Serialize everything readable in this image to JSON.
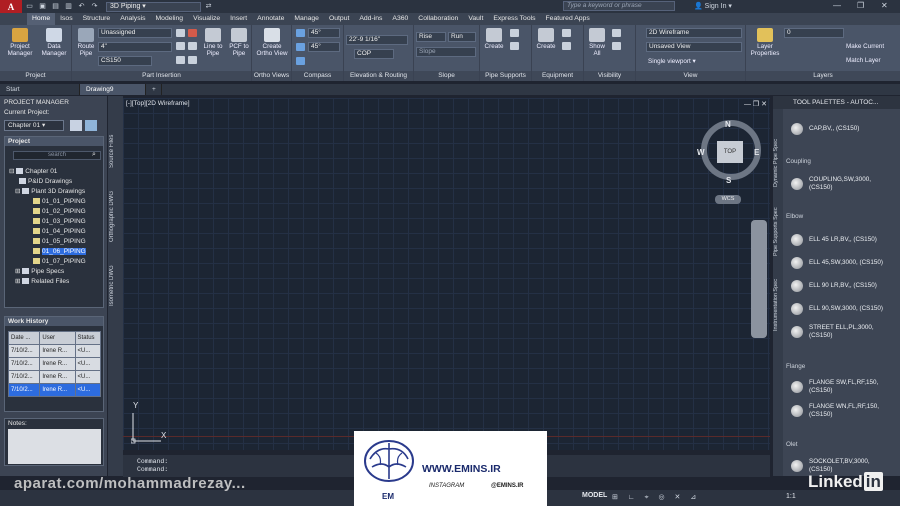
{
  "titlebar": {
    "logo": "A",
    "logo_sub": "P3D",
    "workspace": "3D Piping",
    "app_title": "",
    "search_placeholder": "Type a keyword or phrase",
    "signin": "Sign In"
  },
  "menubar": {
    "tabs": [
      "Home",
      "Isos",
      "Structure",
      "Analysis",
      "Modeling",
      "Visualize",
      "Insert",
      "Annotate",
      "Manage",
      "Output",
      "Add-ins",
      "A360",
      "Collaboration",
      "Vault",
      "Express Tools",
      "Featured Apps"
    ],
    "active": "Home"
  },
  "ribbon": {
    "project_panel": {
      "title": "Project",
      "buttons": [
        "Project Manager",
        "Data Manager"
      ]
    },
    "part_insertion": {
      "title": "Part Insertion",
      "buttons": [
        "Route Pipe",
        "Line to Pipe",
        "PCF to Pipe"
      ],
      "spec_value": "Unassigned",
      "size_value": "4\"",
      "spec2_value": "CS150"
    },
    "ortho_views": {
      "title": "Ortho Views",
      "buttons": [
        "Create Ortho View"
      ]
    },
    "compass": {
      "title": "Compass",
      "angle1": "45°",
      "angle2": "45°"
    },
    "elevation": {
      "title": "Elevation & Routing",
      "elev_value": "22'-9 1/16\"",
      "cop": "COP"
    },
    "slope": {
      "title": "Slope",
      "rise": "Rise",
      "run": "Run",
      "slope": "Slope"
    },
    "pipe_supports": {
      "title": "Pipe Supports",
      "buttons": [
        "Create"
      ]
    },
    "equipment": {
      "title": "Equipment",
      "buttons": [
        "Create"
      ]
    },
    "visibility": {
      "title": "Visibility",
      "buttons": [
        "Show All"
      ]
    },
    "view": {
      "title": "View",
      "visual_style": "2D Wireframe",
      "named_view": "Unsaved View",
      "viewport": "Single viewport"
    },
    "layers": {
      "title": "Layers",
      "buttons": [
        "Layer Properties",
        "Make Current",
        "Match Layer"
      ],
      "layer_value": "0"
    }
  },
  "file_tabs": [
    "Start",
    "Drawing9"
  ],
  "project_manager": {
    "title": "PROJECT MANAGER",
    "current_project_label": "Current Project:",
    "current_project": "Chapter 01",
    "project_header": "Project",
    "search": "search",
    "tree": [
      "Chapter 01",
      "P&ID Drawings",
      "Plant 3D Drawings",
      "01_01_PIPING",
      "01_02_PIPING",
      "01_03_PIPING",
      "01_04_PIPING",
      "01_05_PIPING",
      "01_06_PIPING",
      "01_07_PIPING",
      "Pipe Specs",
      "Related Files"
    ],
    "selected_index": 8,
    "work_history": {
      "title": "Work History",
      "columns": [
        "Date ...",
        "User",
        "Status"
      ],
      "rows": [
        [
          "7/10/2...",
          "Irene R...",
          "<U..."
        ],
        [
          "7/10/2...",
          "Irene R...",
          "<U..."
        ],
        [
          "7/10/2...",
          "Irene R...",
          "<U..."
        ],
        [
          "7/10/2...",
          "Irene R...",
          "<U..."
        ]
      ],
      "highlight_row": 3
    },
    "notes_label": "Notes:"
  },
  "side_tabs": [
    "Source Files",
    "Orthographic DWG",
    "Isometric DWG"
  ],
  "viewport": {
    "label": "[-][Top][2D Wireframe]",
    "compass": {
      "n": "N",
      "s": "S",
      "e": "E",
      "w": "W",
      "top": "TOP",
      "wcs": "WCS"
    },
    "ucs_x": "X",
    "ucs_y": "Y"
  },
  "command": {
    "line1": "Command:",
    "line2": "Command:",
    "input_placeholder": "Type a command"
  },
  "tool_palettes": {
    "title": "TOOL PALETTES - AUTOC...",
    "side_tabs": [
      "Dynamic Pipe Spec",
      "Pipe Supports Spec",
      "Instrumentation Spec"
    ],
    "items": [
      {
        "type": "item",
        "text": "CAP,BV,, (CS150)"
      },
      {
        "type": "header",
        "text": "Coupling"
      },
      {
        "type": "item",
        "text": "COUPLING,SW,3000, (CS150)"
      },
      {
        "type": "header",
        "text": "Elbow"
      },
      {
        "type": "item",
        "text": "ELL 45 LR,BV,, (CS150)"
      },
      {
        "type": "item",
        "text": "ELL 45,SW,3000, (CS150)"
      },
      {
        "type": "item",
        "text": "ELL 90 LR,BV,, (CS150)"
      },
      {
        "type": "item",
        "text": "ELL 90,SW,3000, (CS150)"
      },
      {
        "type": "item",
        "text": "STREET ELL,PL,3000, (CS150)"
      },
      {
        "type": "header",
        "text": "Flange"
      },
      {
        "type": "item",
        "text": "FLANGE SW,FL,RF,150, (CS150)"
      },
      {
        "type": "item",
        "text": "FLANGE WN,FL,RF,150, (CS150)"
      },
      {
        "type": "header",
        "text": "Olet"
      },
      {
        "type": "item",
        "text": "SOCKOLET,BV,3000, (CS150)"
      }
    ]
  },
  "statusbar": {
    "model": "MODEL",
    "scale": "1:1"
  },
  "watermarks": {
    "aparat": "aparat.com/mohammadrezay...",
    "linkedin": "Linked",
    "linkedin_in": "in",
    "emins_web": "WWW.EMINS.IR",
    "emins_ig": "INSTAGRAM",
    "emins_at": "@EMINS.IR",
    "emins_text": "EM"
  },
  "colors": {
    "accent": "#2d6cdf",
    "brand_red": "#b01e23"
  }
}
